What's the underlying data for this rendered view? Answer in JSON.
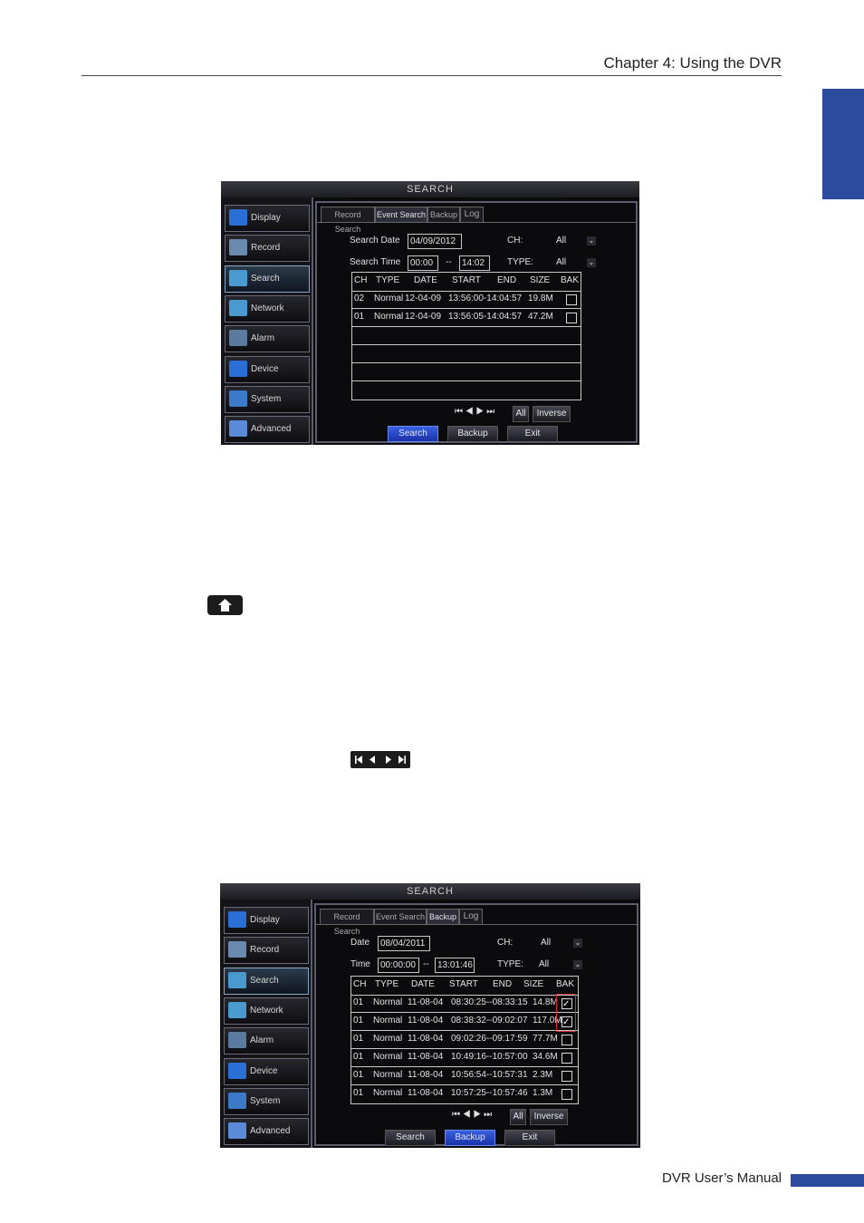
{
  "header": {
    "title": "Chapter 4: Using the DVR"
  },
  "footer": {
    "title": "DVR User’s Manual"
  },
  "dvr_menu": [
    "Display",
    "Record",
    "Search",
    "Network",
    "Alarm",
    "Device",
    "System",
    "Advanced"
  ],
  "colors": {
    "brand": "#2d4b9e",
    "screen_bg": "#0b0b0d",
    "primary_button": "#2a48d0",
    "highlight": "#d03030"
  },
  "screenshot1": {
    "title": "SEARCH",
    "tabs": [
      "Record Search",
      "Event Search",
      "Backup",
      "Log"
    ],
    "active_tab": "Event Search",
    "search_date_label": "Search Date",
    "search_date": "04/09/2012",
    "search_time_label": "Search Time",
    "time_from": "00:00",
    "time_sep": "--",
    "time_to": "14:02",
    "ch_label": "CH:",
    "ch_value": "All",
    "type_label": "TYPE:",
    "type_value": "All",
    "columns": [
      "CH",
      "TYPE",
      "DATE",
      "START",
      "END",
      "SIZE",
      "BAK"
    ],
    "rows": [
      {
        "ch": "02",
        "type": "Normal",
        "date": "12-04-09",
        "range": "13:56:00-14:04:57",
        "size": "19.8M",
        "checked": false
      },
      {
        "ch": "01",
        "type": "Normal",
        "date": "12-04-09",
        "range": "13:56:05-14:04:57",
        "size": "47.2M",
        "checked": false
      }
    ],
    "nav": "⏮ ◀ ▶ ⏭",
    "all_label": "All",
    "inverse_label": "Inverse",
    "search_btn": "Search",
    "backup_btn": "Backup",
    "exit_btn": "Exit"
  },
  "screenshot2": {
    "title": "SEARCH",
    "tabs": [
      "Record Search",
      "Event Search",
      "Backup",
      "Log"
    ],
    "active_tab": "Backup",
    "date_label": "Date",
    "date": "08/04/2011",
    "time_label": "Time",
    "time_from": "00:00:00",
    "time_sep": "--",
    "time_to": "13:01:46",
    "ch_label": "CH:",
    "ch_value": "All",
    "type_label": "TYPE:",
    "type_value": "All",
    "columns": [
      "CH",
      "TYPE",
      "DATE",
      "START",
      "END",
      "SIZE",
      "BAK"
    ],
    "rows": [
      {
        "ch": "01",
        "type": "Normal",
        "date": "11-08-04",
        "range": "08:30:25--08:33:15",
        "size": "14.8M",
        "checked": true
      },
      {
        "ch": "01",
        "type": "Normal",
        "date": "11-08-04",
        "range": "08:38:32--09:02:07",
        "size": "117.0M",
        "checked": true
      },
      {
        "ch": "01",
        "type": "Normal",
        "date": "11-08-04",
        "range": "09:02:26--09:17:59",
        "size": "77.7M",
        "checked": false
      },
      {
        "ch": "01",
        "type": "Normal",
        "date": "11-08-04",
        "range": "10:49:16--10:57:00",
        "size": "34.6M",
        "checked": false
      },
      {
        "ch": "01",
        "type": "Normal",
        "date": "11-08-04",
        "range": "10:56:54--10:57:31",
        "size": "2.3M",
        "checked": false
      },
      {
        "ch": "01",
        "type": "Normal",
        "date": "11-08-04",
        "range": "10:57:25--10:57:46",
        "size": "1.3M",
        "checked": false
      }
    ],
    "nav": "⏮ ◀ ▶ ⏭",
    "all_label": "All",
    "inverse_label": "Inverse",
    "search_btn": "Search",
    "backup_btn": "Backup",
    "exit_btn": "Exit"
  }
}
